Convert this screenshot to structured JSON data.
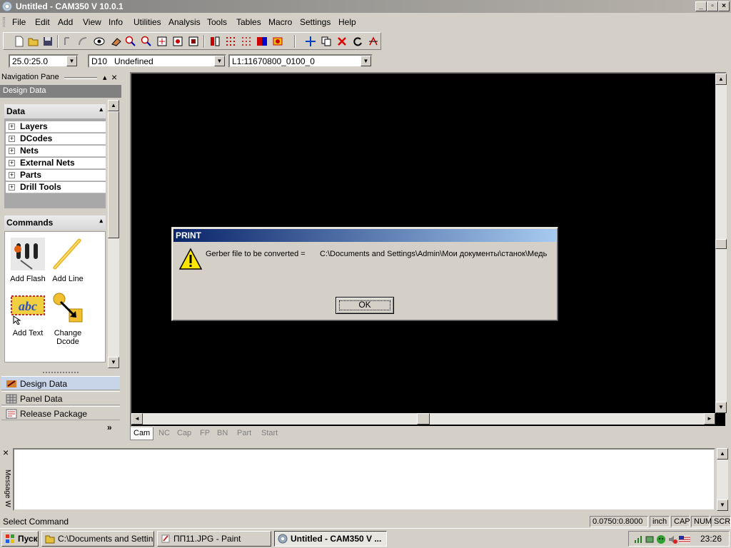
{
  "window": {
    "title": "Untitled - CAM350 V 10.0.1"
  },
  "menu": [
    "File",
    "Edit",
    "Add",
    "View",
    "Info",
    "Utilities",
    "Analysis",
    "Tools",
    "Tables",
    "Macro",
    "Settings",
    "Help"
  ],
  "combos": {
    "grid": "25.0:25.0",
    "dcode": "D10   Undefined",
    "layer": "L1:11670800_0100_0"
  },
  "nav": {
    "header": "Navigation Pane",
    "title": "Design Data",
    "data_section": "Data",
    "tree": [
      "Layers",
      "DCodes",
      "Nets",
      "External Nets",
      "Parts",
      "Drill Tools"
    ],
    "commands_section": "Commands",
    "commands": [
      "Add Flash",
      "Add Line",
      "Add Text",
      "Change Dcode"
    ],
    "bottom": [
      "Design Data",
      "Panel Data",
      "Release Package"
    ]
  },
  "tabs": [
    "Cam",
    "NC",
    "Cap",
    "FP",
    "BN",
    "Part",
    "Start"
  ],
  "message": {
    "label": "Message W"
  },
  "status": {
    "text": "Select Command",
    "coords": "0.0750:0.8000",
    "units": "inch",
    "cap": "CAP",
    "num": "NUM",
    "scrl": "SCRL"
  },
  "dialog": {
    "title": "PRINT",
    "label": "Gerber file to be converted =",
    "path": "C:\\Documents and Settings\\Admin\\Мои документы\\станок\\Медь",
    "ok": "OK"
  },
  "taskbar": {
    "start": "Пуск",
    "items": [
      "C:\\Documents and Settin...",
      "ПП11.JPG - Paint",
      "Untitled - CAM350 V ..."
    ],
    "clock": "23:26"
  }
}
